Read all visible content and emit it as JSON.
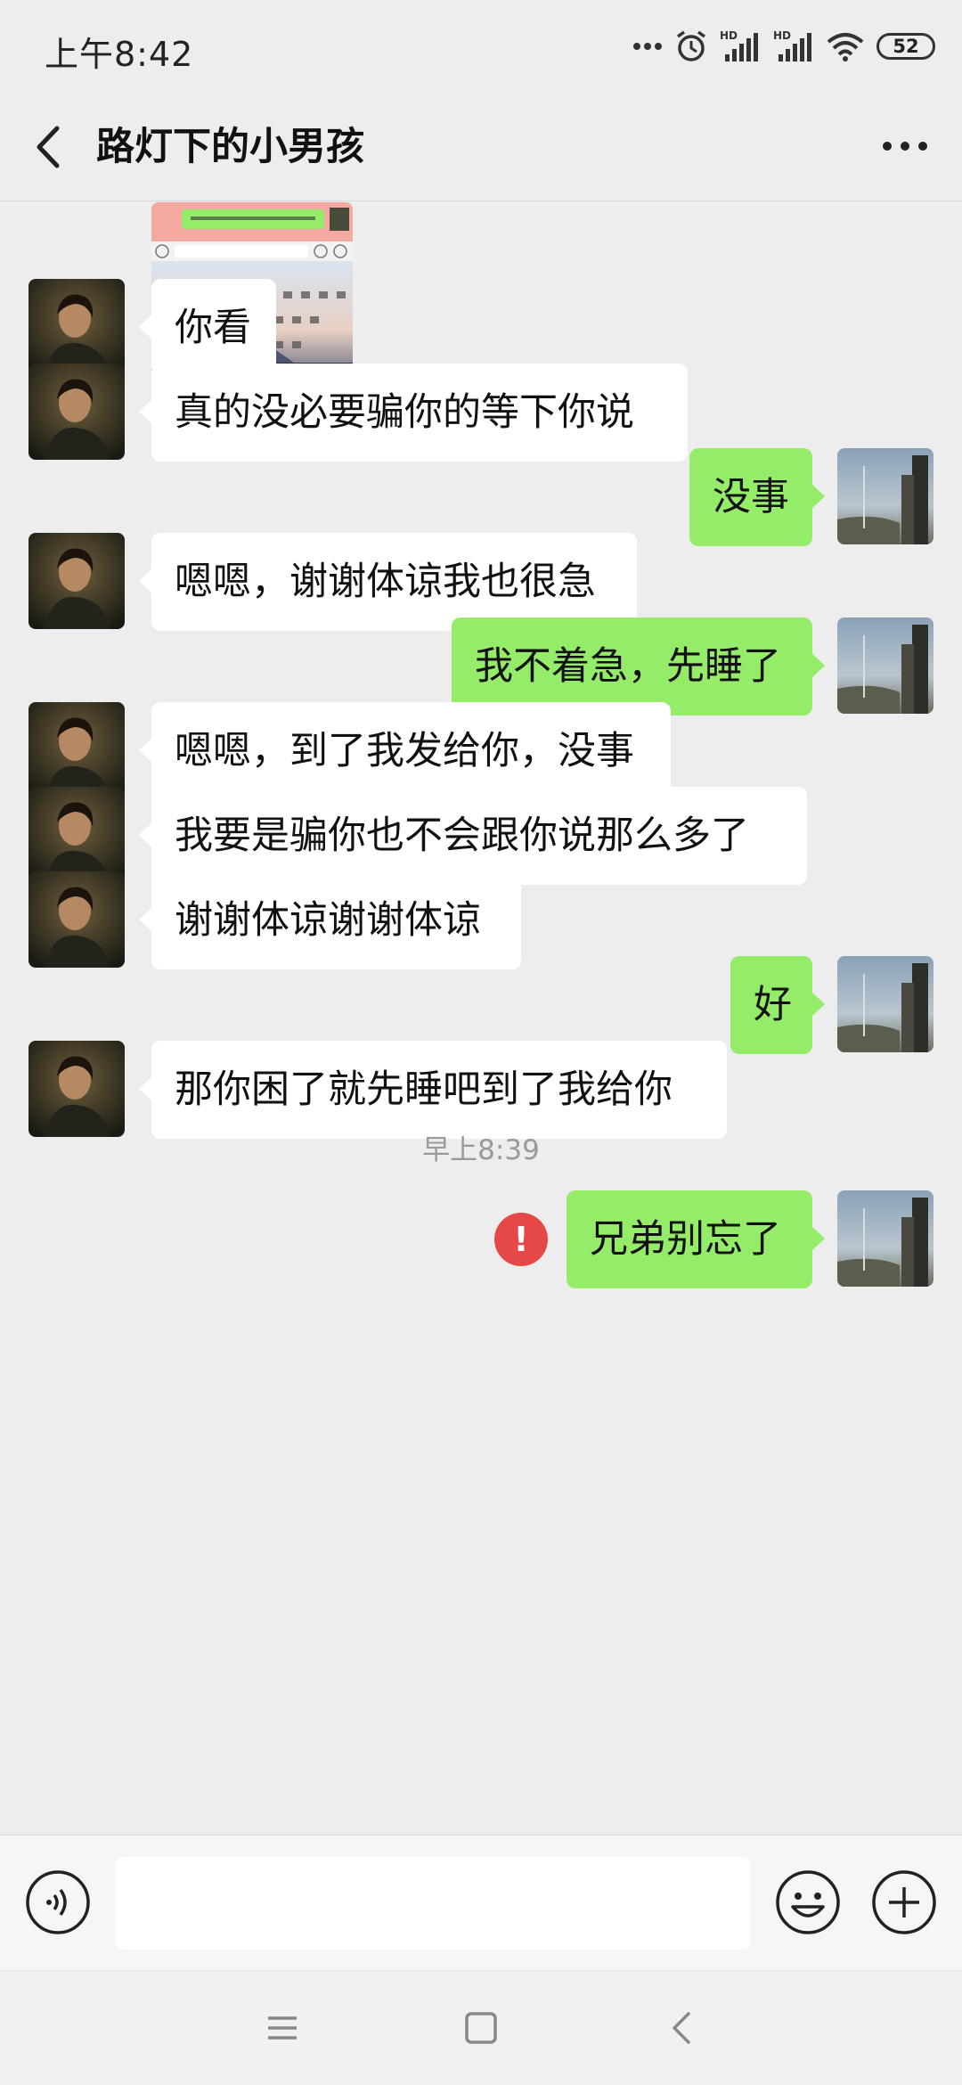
{
  "status_bar": {
    "time": "上午8:42",
    "battery": "52",
    "icons": [
      "more-dots-icon",
      "alarm-icon",
      "hd-signal-icon",
      "hd-signal-icon",
      "wifi-icon",
      "battery-icon"
    ]
  },
  "header": {
    "title": "路灯下的小男孩",
    "back_icon": "back-arrow-icon",
    "more_icon": "more-icon"
  },
  "messages": [
    {
      "side": "in",
      "type": "image",
      "text": "",
      "icon": "keyboard-screenshot-image"
    },
    {
      "side": "in",
      "type": "text",
      "text": "你看"
    },
    {
      "side": "in",
      "type": "text",
      "text": "真的没必要骗你的等下你说"
    },
    {
      "side": "out",
      "type": "text",
      "text": "没事"
    },
    {
      "side": "in",
      "type": "text",
      "text": "嗯嗯，谢谢体谅我也很急"
    },
    {
      "side": "out",
      "type": "text",
      "text": "我不着急，先睡了"
    },
    {
      "side": "in",
      "type": "text",
      "text": "嗯嗯，到了我发给你，没事"
    },
    {
      "side": "in",
      "type": "text",
      "text": "我要是骗你也不会跟你说那么多了"
    },
    {
      "side": "in",
      "type": "text",
      "text": "谢谢体谅谢谢体谅"
    },
    {
      "side": "out",
      "type": "text",
      "text": "好"
    },
    {
      "side": "in",
      "type": "text",
      "text": "那你困了就先睡吧到了我给你"
    },
    {
      "side": "out",
      "type": "text",
      "text": "兄弟别忘了",
      "status": "failed"
    }
  ],
  "timestamp": "早上8:39",
  "error_mark": "!",
  "input_bar": {
    "placeholder": "",
    "value": "",
    "voice_icon": "voice-icon",
    "emoji_icon": "emoji-icon",
    "plus_icon": "plus-icon"
  },
  "system_nav": {
    "icons": [
      "menu-icon",
      "home-icon",
      "back-icon"
    ]
  },
  "colors": {
    "background": "#ededed",
    "outgoing_bubble": "#95ec69",
    "incoming_bubble": "#ffffff",
    "error": "#e54846"
  }
}
